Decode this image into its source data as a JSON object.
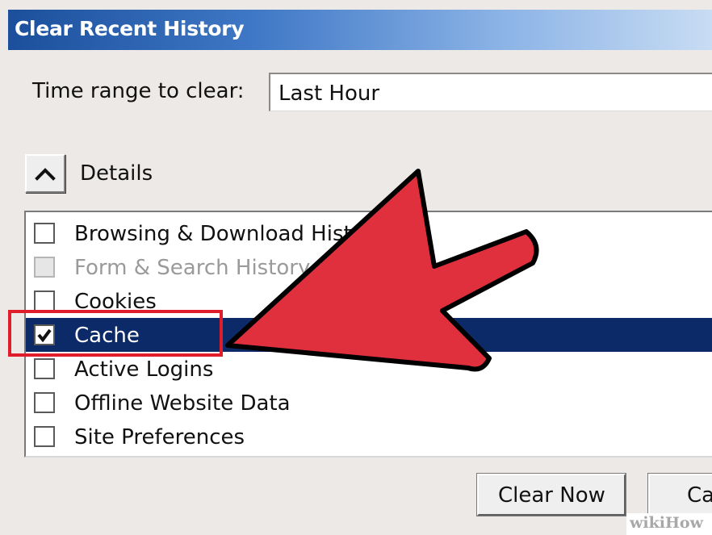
{
  "dialog": {
    "title": "Clear Recent History",
    "time_range_label": "Time range to clear:",
    "time_range_value": "Last Hour",
    "details_label": "Details",
    "items": [
      {
        "label": "Browsing & Download Hist",
        "checked": false,
        "disabled": false,
        "selected": false
      },
      {
        "label": "Form & Search History",
        "checked": false,
        "disabled": true,
        "selected": false
      },
      {
        "label": "Cookies",
        "checked": false,
        "disabled": false,
        "selected": false
      },
      {
        "label": "Cache",
        "checked": true,
        "disabled": false,
        "selected": true
      },
      {
        "label": "Active Logins",
        "checked": false,
        "disabled": false,
        "selected": false
      },
      {
        "label": "Offline Website Data",
        "checked": false,
        "disabled": false,
        "selected": false
      },
      {
        "label": "Site Preferences",
        "checked": false,
        "disabled": false,
        "selected": false
      }
    ],
    "clear_now_label": "Clear Now",
    "cancel_label": "Ca"
  },
  "annotation": {
    "arrow_color": "#e1303d",
    "highlight_color": "#e01d2a"
  },
  "watermark": "wikiHow"
}
